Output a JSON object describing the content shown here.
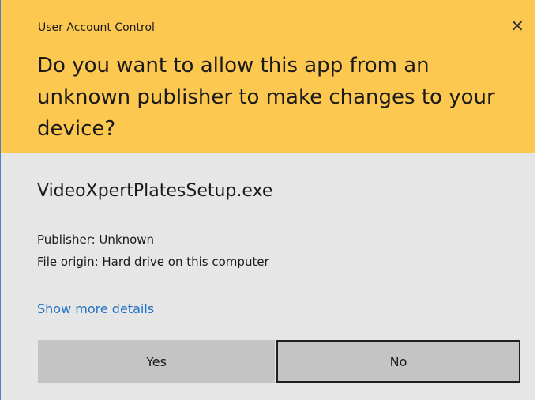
{
  "dialog": {
    "window_title": "User Account Control",
    "close_glyph": "✕",
    "question": "Do you want to allow this app from an unknown publisher to make changes to your device?",
    "app_name": "VideoXpertPlatesSetup.exe",
    "publisher_line": "Publisher: Unknown",
    "origin_line": "File origin: Hard drive on this computer",
    "details_link": "Show more details",
    "yes_label": "Yes",
    "no_label": "No"
  },
  "colors": {
    "header_bg": "#fcc84f",
    "body_bg": "#e6e6e6",
    "link": "#1f73c7",
    "button_bg": "#c4c4c4"
  }
}
